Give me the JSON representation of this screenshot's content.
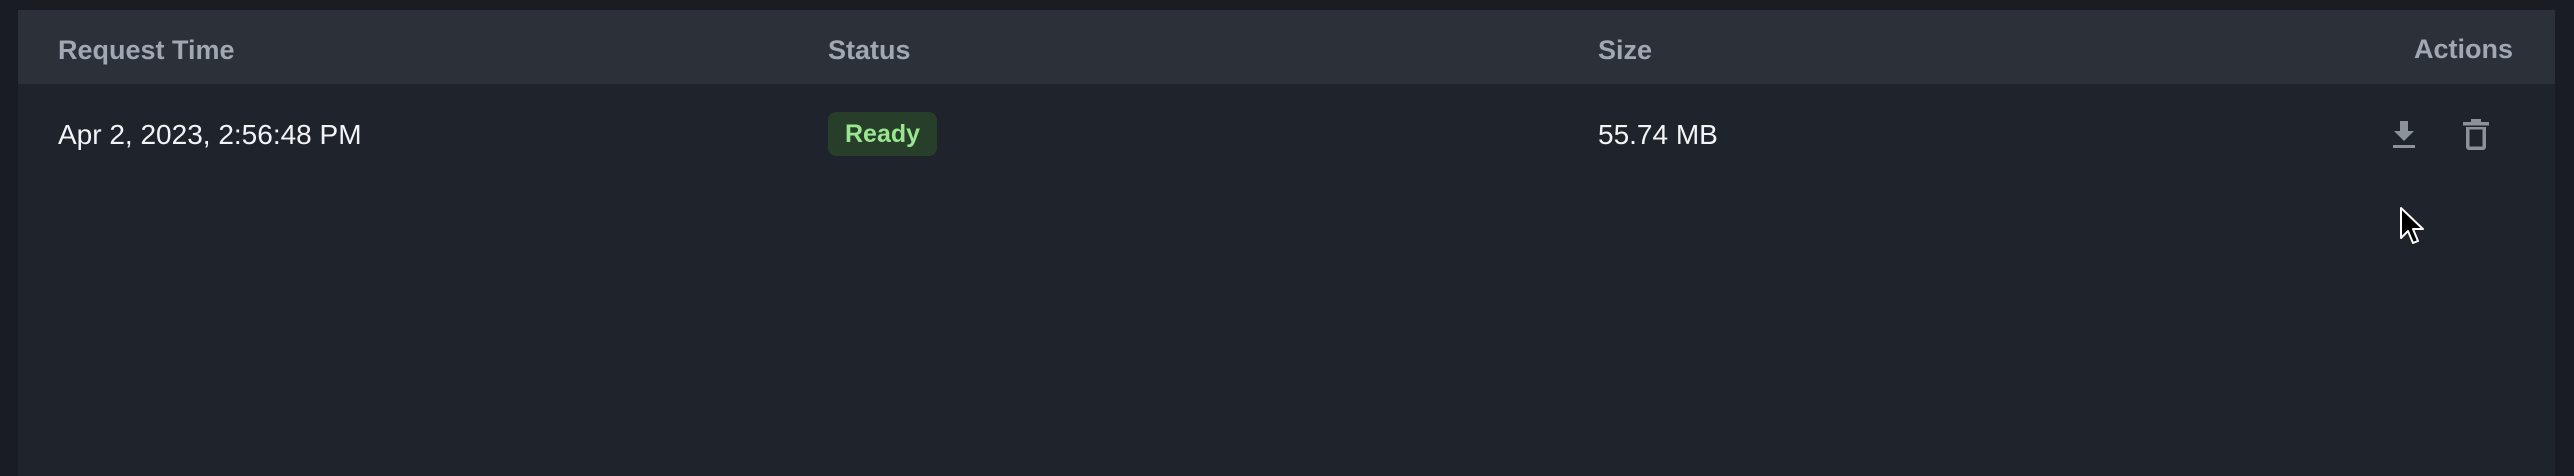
{
  "table": {
    "headers": {
      "request_time": "Request Time",
      "status": "Status",
      "size": "Size",
      "actions": "Actions"
    },
    "rows": [
      {
        "request_time": "Apr 2, 2023, 2:56:48 PM",
        "status": "Ready",
        "size": "55.74 MB",
        "actions": [
          "download-icon",
          "trash-icon"
        ]
      }
    ]
  },
  "colors": {
    "background": "#1f232b",
    "header_background": "#2b3039",
    "status_ready_bg": "#263e2a",
    "status_ready_text": "#9ae68f"
  }
}
